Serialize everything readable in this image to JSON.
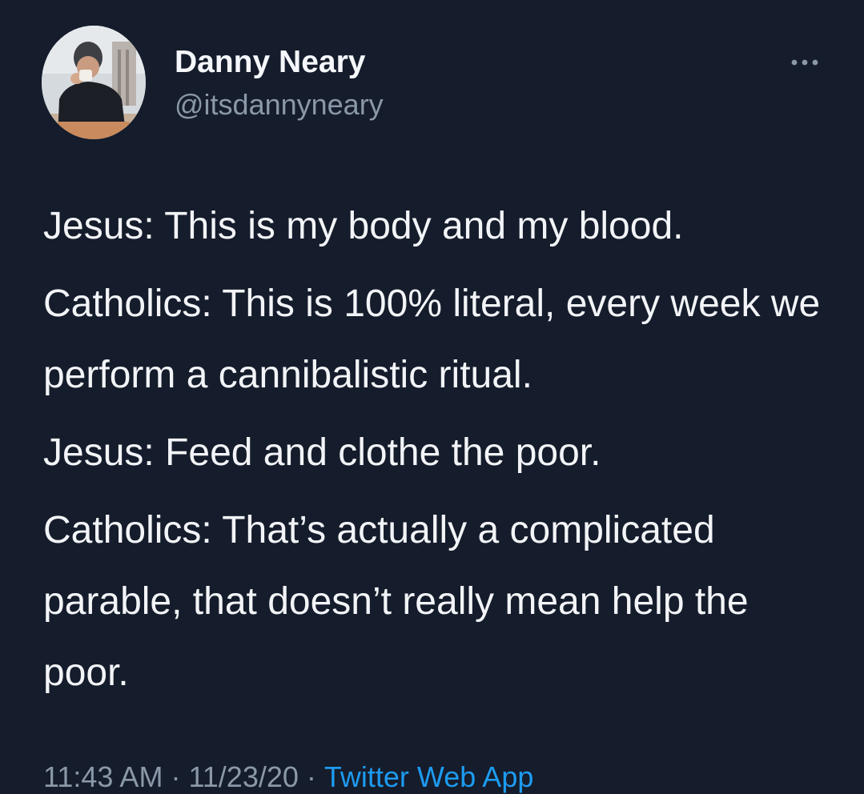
{
  "author": {
    "display_name": "Danny Neary",
    "handle": "@itsdannyneary",
    "avatar_icon": "profile-photo"
  },
  "more_icon": "ellipsis-icon",
  "tweet": {
    "paragraphs": [
      "Jesus: This is my body and my blood.",
      "Catholics: This is 100% literal, every week we perform a cannibalistic ritual.",
      "Jesus: Feed and clothe the poor.",
      "Catholics: That’s actually a complicated parable, that doesn’t really mean help the poor."
    ]
  },
  "meta": {
    "time": "11:43 AM",
    "date": "11/23/20",
    "separator": "·",
    "source": "Twitter Web App"
  },
  "colors": {
    "background": "#151c2b",
    "text": "#f2f4f7",
    "secondary_text": "#8a98a8",
    "link": "#1d9bf0"
  }
}
